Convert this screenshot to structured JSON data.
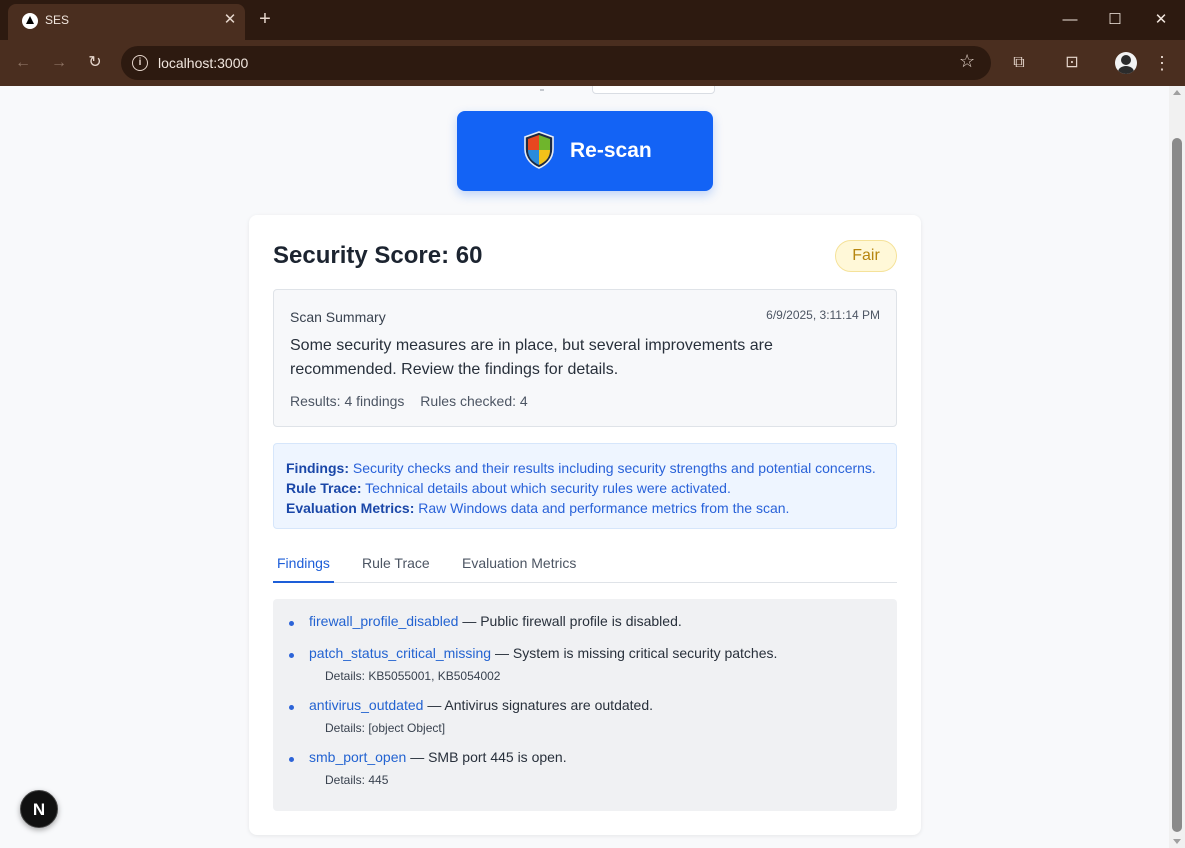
{
  "browser": {
    "tab_title": "SES",
    "url": "localhost:3000",
    "icons": {
      "back": "arrow-left-icon",
      "forward": "arrow-right-icon",
      "reload": "reload-icon",
      "info": "info-icon",
      "star": "star-icon",
      "extensions": "puzzle-icon",
      "cast": "media-icon",
      "menu": "more-vert-icon"
    },
    "colors": {
      "frame": "#2d1a10",
      "toolbar": "#4a2e1f"
    }
  },
  "page": {
    "rescan_button": {
      "label": "Re-scan",
      "color": "#1363f5"
    },
    "score": {
      "title": "Security Score: 60",
      "badge": "Fair"
    },
    "summary": {
      "label": "Scan Summary",
      "timestamp": "6/9/2025, 3:11:14 PM",
      "text": "Some security measures are in place, but several improvements are recommended. Review the findings for details.",
      "results": "Results: 4 findings",
      "rules_checked": "Rules checked: 4"
    },
    "info": [
      {
        "term": "Findings:",
        "desc": "Security checks and their results including security strengths and potential concerns."
      },
      {
        "term": "Rule Trace:",
        "desc": "Technical details about which security rules were activated."
      },
      {
        "term": "Evaluation Metrics:",
        "desc": "Raw Windows data and performance metrics from the scan."
      }
    ],
    "tabs": [
      {
        "label": "Findings",
        "active": true
      },
      {
        "label": "Rule Trace",
        "active": false
      },
      {
        "label": "Evaluation Metrics",
        "active": false
      }
    ],
    "findings": [
      {
        "code": "firewall_profile_disabled",
        "text": "— Public firewall profile is disabled.",
        "details": ""
      },
      {
        "code": "patch_status_critical_missing",
        "text": "— System is missing critical security patches.",
        "details": "Details: KB5055001, KB5054002"
      },
      {
        "code": "antivirus_outdated",
        "text": "— Antivirus signatures are outdated.",
        "details": "Details: [object Object]"
      },
      {
        "code": "smb_port_open",
        "text": "— SMB port 445 is open.",
        "details": "Details: 445"
      }
    ],
    "dev_badge": "N"
  }
}
